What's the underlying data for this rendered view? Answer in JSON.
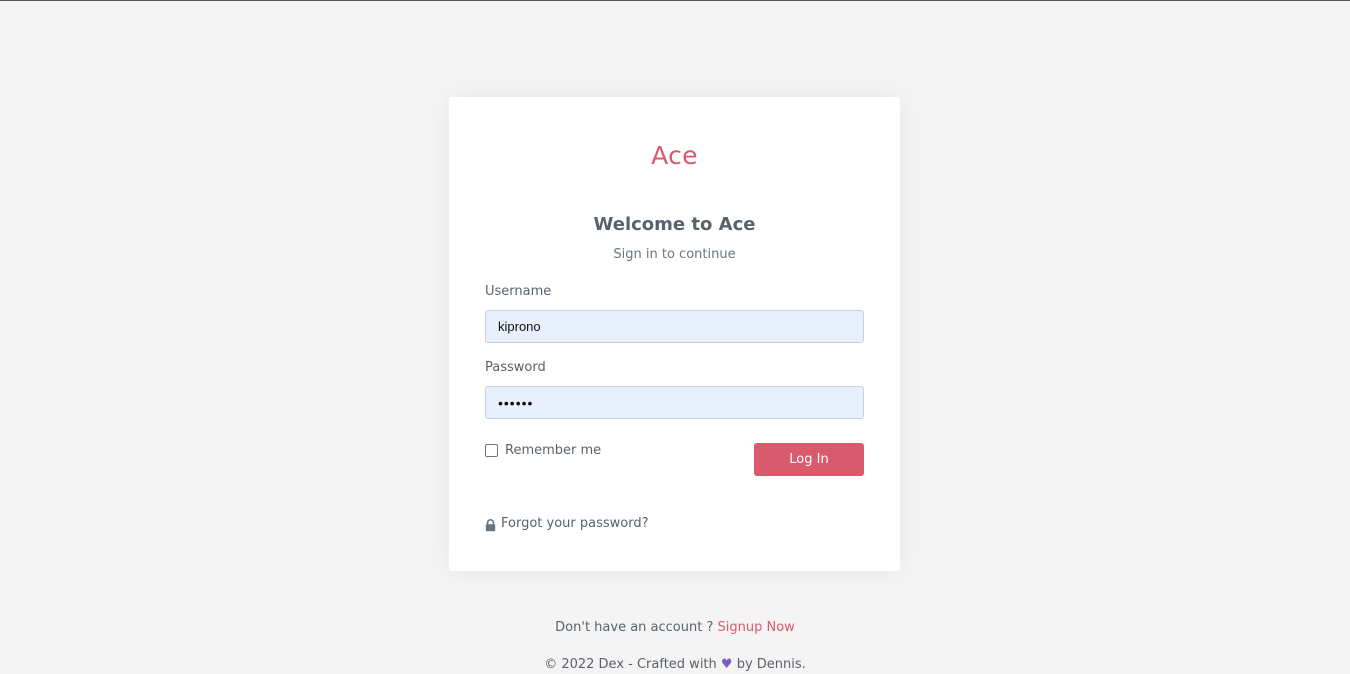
{
  "brand": {
    "name": "Ace",
    "color": "#d9596d"
  },
  "login": {
    "welcome": "Welcome to Ace",
    "subtitle": "Sign in to continue",
    "username_label": "Username",
    "username_value": "kiprono",
    "password_label": "Password",
    "password_value": "••••••",
    "remember_label": "Remember me",
    "remember_checked": false,
    "login_button": "Log In",
    "forgot_link": "Forgot your password?",
    "forgot_icon": "lock-icon"
  },
  "footer": {
    "signup_prompt": "Don't have an account ?",
    "signup_link": "Signup Now",
    "credit_prefix": "© 2022 Dex - Crafted with",
    "heart_icon": "heart-icon",
    "heart_glyph": "♥",
    "heart_color": "#7c5cc4",
    "credit_suffix": "by Dennis."
  },
  "colors": {
    "background": "#f4f4f4",
    "accent": "#d9596d",
    "input_fill": "#e8f0fe"
  }
}
